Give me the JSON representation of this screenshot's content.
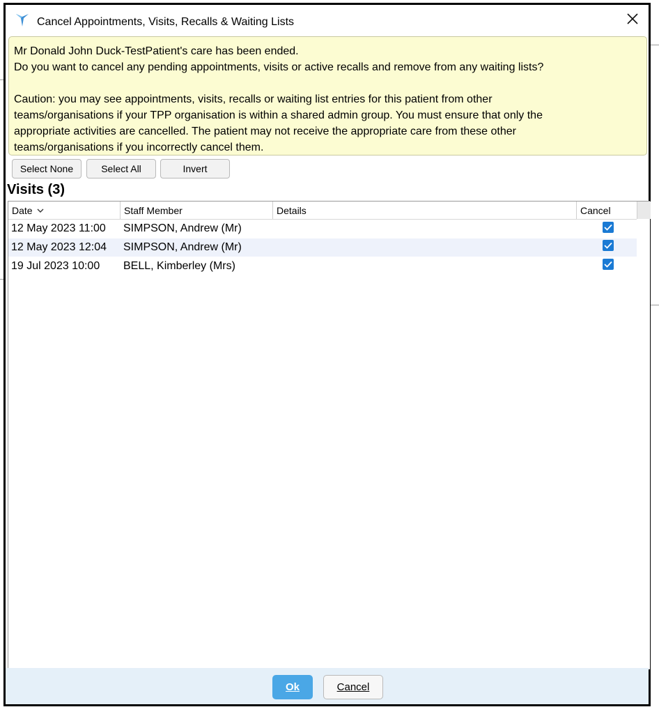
{
  "window": {
    "title": "Cancel Appointments, Visits, Recalls & Waiting Lists",
    "logo_icon": "tpp-systmone-logo-icon",
    "close_icon": "close-icon"
  },
  "info": {
    "line1": "Mr Donald John Duck-TestPatient's care has been ended.",
    "line2": "Do you want to cancel any pending appointments, visits or active recalls and remove from any waiting lists?",
    "caution1": "Caution: you may see appointments, visits, recalls or waiting list entries for this patient from other",
    "caution2": "teams/organisations if your TPP organisation is within a shared admin group. You must ensure that only the",
    "caution3": "appropriate activities are cancelled. The patient may not receive the appropriate care from these other",
    "caution4": "teams/organisations if you incorrectly cancel them."
  },
  "toolbar": {
    "select_none": "Select None",
    "select_all": "Select All",
    "invert": "Invert"
  },
  "section": {
    "title": "Visits (3)"
  },
  "table": {
    "columns": {
      "date": "Date",
      "staff": "Staff Member",
      "details": "Details",
      "cancel": "Cancel"
    },
    "sort_icon": "chevron-down-icon",
    "rows": [
      {
        "date": "12 May 2023 11:00",
        "staff": "SIMPSON, Andrew (Mr)",
        "details": "",
        "cancel": true
      },
      {
        "date": "12 May 2023 12:04",
        "staff": "SIMPSON, Andrew (Mr)",
        "details": "",
        "cancel": true
      },
      {
        "date": "19 Jul 2023 10:00",
        "staff": "BELL, Kimberley (Mrs)",
        "details": "",
        "cancel": true
      }
    ]
  },
  "footer": {
    "ok": "Ok",
    "cancel": "Cancel"
  },
  "colors": {
    "info_bg": "#fcfcd2",
    "checkbox": "#1a7ad4",
    "ok_button": "#4aa7e6",
    "footer_bg": "#e5f0f9",
    "alt_row": "#eef2fb"
  }
}
